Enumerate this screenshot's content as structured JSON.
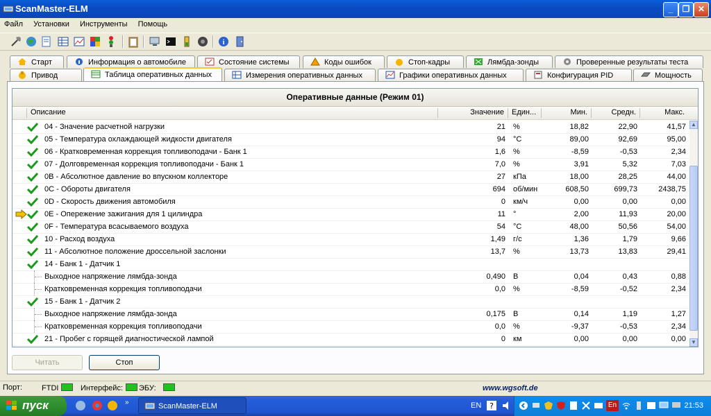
{
  "window": {
    "title": "ScanMaster-ELM"
  },
  "menu": [
    "Файл",
    "Установки",
    "Инструменты",
    "Помощь"
  ],
  "tabs_row1": [
    {
      "label": "Старт",
      "icon": "start-icon"
    },
    {
      "label": "Информация о автомобиле",
      "icon": "info-icon"
    },
    {
      "label": "Состояние системы",
      "icon": "checklist-icon"
    },
    {
      "label": "Коды ошибок",
      "icon": "warning-icon"
    },
    {
      "label": "Стоп-кадры",
      "icon": "freeze-frame-icon"
    },
    {
      "label": "Лямбда-зонды",
      "icon": "oxygen-sensor-icon"
    },
    {
      "label": "Проверенные результаты теста",
      "icon": "gear-icon"
    }
  ],
  "tabs_row2": [
    {
      "label": "Привод",
      "icon": "drive-icon"
    },
    {
      "label": "Таблица оперативных данных",
      "icon": "table-icon"
    },
    {
      "label": "Измерения оперативных данных",
      "icon": "grid-icon"
    },
    {
      "label": "Графики оперативных данных",
      "icon": "chart-icon"
    },
    {
      "label": "Конфигурация PID",
      "icon": "config-icon"
    },
    {
      "label": "Мощность",
      "icon": "power-icon"
    }
  ],
  "grid": {
    "title": "Оперативные данные (Режим 01)",
    "columns": {
      "desc": "Описание",
      "value": "Значение",
      "unit": "Един...",
      "min": "Мин.",
      "avg": "Средн.",
      "max": "Макс."
    },
    "rows": [
      {
        "icon": "check",
        "desc": "04 - Значение расчетной нагрузки",
        "value": "21",
        "unit": "%",
        "min": "18,82",
        "avg": "22,90",
        "max": "41,57"
      },
      {
        "icon": "check",
        "desc": "05 - Температура охлаждающей жидкости двигателя",
        "value": "94",
        "unit": "°C",
        "min": "89,00",
        "avg": "92,69",
        "max": "95,00"
      },
      {
        "icon": "check",
        "desc": "06 - Кратковременная коррекция топливоподачи - Банк 1",
        "value": "1,6",
        "unit": "%",
        "min": "-8,59",
        "avg": "-0,53",
        "max": "2,34"
      },
      {
        "icon": "check",
        "desc": "07 - Долговременная коррекция топливоподачи - Банк 1",
        "value": "7,0",
        "unit": "%",
        "min": "3,91",
        "avg": "5,32",
        "max": "7,03"
      },
      {
        "icon": "check",
        "desc": "0B - Абсолютное давление во впускном коллекторе",
        "value": "27",
        "unit": "кПа",
        "min": "18,00",
        "avg": "28,25",
        "max": "44,00"
      },
      {
        "icon": "check",
        "desc": "0C - Обороты двигателя",
        "value": "694",
        "unit": "об/мин",
        "min": "608,50",
        "avg": "699,73",
        "max": "2438,75"
      },
      {
        "icon": "check",
        "desc": "0D - Скорость движения автомобиля",
        "value": "0",
        "unit": "км/ч",
        "min": "0,00",
        "avg": "0,00",
        "max": "0,00"
      },
      {
        "icon": "arrow",
        "desc": "0E - Опережение зажигания для 1 цилиндра",
        "value": "11",
        "unit": "°",
        "min": "2,00",
        "avg": "11,93",
        "max": "20,00"
      },
      {
        "icon": "check",
        "desc": "0F - Температура всасываемого воздуха",
        "value": "54",
        "unit": "°C",
        "min": "48,00",
        "avg": "50,56",
        "max": "54,00"
      },
      {
        "icon": "check",
        "desc": "10 - Расход воздуха",
        "value": "1,49",
        "unit": "г/с",
        "min": "1,36",
        "avg": "1,79",
        "max": "9,66"
      },
      {
        "icon": "check",
        "desc": "11 - Абсолютное положение дроссельной заслонки",
        "value": "13,7",
        "unit": "%",
        "min": "13,73",
        "avg": "13,83",
        "max": "29,41"
      },
      {
        "icon": "check",
        "desc": "14 - Банк 1 - Датчик 1",
        "value": "",
        "unit": "",
        "min": "",
        "avg": "",
        "max": ""
      },
      {
        "icon": "tree",
        "desc": "Выходное напряжение лямбда-зонда",
        "value": "0,490",
        "unit": "В",
        "min": "0,04",
        "avg": "0,43",
        "max": "0,88"
      },
      {
        "icon": "tree",
        "desc": "Кратковременная коррекция топливоподачи",
        "value": "0,0",
        "unit": "%",
        "min": "-8,59",
        "avg": "-0,52",
        "max": "2,34"
      },
      {
        "icon": "check",
        "desc": "15 - Банк 1 - Датчик 2",
        "value": "",
        "unit": "",
        "min": "",
        "avg": "",
        "max": ""
      },
      {
        "icon": "tree",
        "desc": "Выходное напряжение лямбда-зонда",
        "value": "0,175",
        "unit": "В",
        "min": "0,14",
        "avg": "1,19",
        "max": "1,27"
      },
      {
        "icon": "tree",
        "desc": "Кратковременная коррекция топливоподачи",
        "value": "0,0",
        "unit": "%",
        "min": "-9,37",
        "avg": "-0,53",
        "max": "2,34"
      },
      {
        "icon": "check",
        "desc": "21 - Пробег с горящей диагностической лампой",
        "value": "0",
        "unit": "км",
        "min": "0,00",
        "avg": "0,00",
        "max": "0,00"
      }
    ]
  },
  "buttons": {
    "read": "Читать",
    "stop": "Стоп"
  },
  "status": {
    "port_label": "Порт:",
    "port_value": "FTDI",
    "interface_label": "Интерфейс:",
    "ecu_label": "ЭБУ:",
    "website": "www.wgsoft.de"
  },
  "taskbar": {
    "start": "пуск",
    "task": "ScanMaster-ELM",
    "lang": "EN",
    "tray_lang": "En",
    "time": "21:53"
  },
  "colors": {
    "accent": "#0a5fd8",
    "led": "#1ec31e",
    "check": "#1a9a1a",
    "arrow": "#f2c200"
  }
}
